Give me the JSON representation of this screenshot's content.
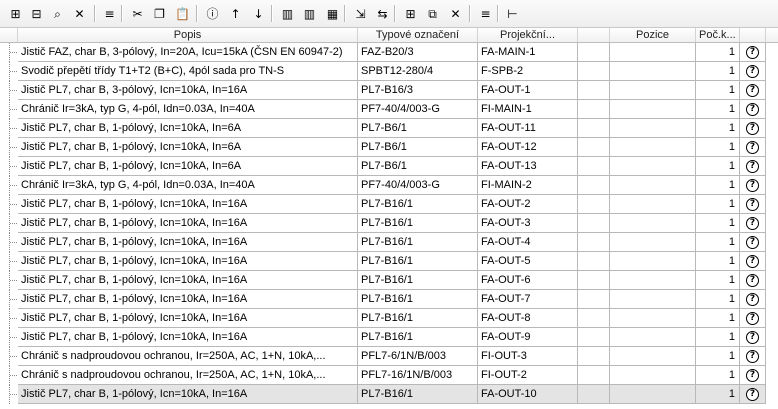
{
  "toolbar": {
    "buttons": [
      {
        "name": "tree-expand-icon",
        "glyph": "⊞"
      },
      {
        "name": "tree-collapse-icon",
        "glyph": "⊟"
      },
      {
        "name": "binoculars-icon",
        "glyph": "⌕"
      },
      {
        "name": "filter-clear-icon",
        "glyph": "✕"
      },
      {
        "name": "numbering-icon",
        "glyph": "≡"
      },
      {
        "name": "cut-icon",
        "glyph": "✂"
      },
      {
        "name": "copy-icon",
        "glyph": "❐"
      },
      {
        "name": "paste-icon",
        "glyph": "📋"
      },
      {
        "name": "info-icon",
        "glyph": "ⓘ"
      },
      {
        "name": "sort-ascending-icon",
        "glyph": "↑"
      },
      {
        "name": "sort-descending-icon",
        "glyph": "↓"
      },
      {
        "name": "columns-left-icon",
        "glyph": "▥"
      },
      {
        "name": "columns-right-icon",
        "glyph": "▥"
      },
      {
        "name": "table-edit-icon",
        "glyph": "▦"
      },
      {
        "name": "move-item-icon",
        "glyph": "⇲"
      },
      {
        "name": "move-insert-icon",
        "glyph": "⇆"
      },
      {
        "name": "split-icon",
        "glyph": "⊞"
      },
      {
        "name": "duplicate-icon",
        "glyph": "⧉"
      },
      {
        "name": "delete-icon",
        "glyph": "✕"
      },
      {
        "name": "renumber-icon",
        "glyph": "≡"
      },
      {
        "name": "align-left-icon",
        "glyph": "⊢"
      }
    ]
  },
  "columns": {
    "popis": "Popis",
    "typ": "Typové označení",
    "projekcni": "Projekční...",
    "pozice": "Pozice",
    "pocet": "Poč.k..."
  },
  "status_icon": "?",
  "colors": {
    "selected_row": "#e4e4e4",
    "grid_line": "#b8b8b8"
  },
  "rows": [
    {
      "popis": "Jistič FAZ, char B, 3-pólový, In=20A, Icu=15kA (ČSN EN 60947-2)",
      "typ": "FAZ-B20/3",
      "projekcni": "FA-MAIN-1",
      "pozice": "",
      "pocet": "1"
    },
    {
      "popis": "Svodič přepětí třídy T1+T2 (B+C), 4pól sada pro TN-S",
      "typ": "SPBT12-280/4",
      "projekcni": "F-SPB-2",
      "pozice": "",
      "pocet": "1"
    },
    {
      "popis": "Jistič PL7, char B, 3-pólový, Icn=10kA, In=16A",
      "typ": "PL7-B16/3",
      "projekcni": "FA-OUT-1",
      "pozice": "",
      "pocet": "1"
    },
    {
      "popis": "Chránič Ir=3kA, typ G, 4-pól, Idn=0.03A, In=40A",
      "typ": "PF7-40/4/003-G",
      "projekcni": "FI-MAIN-1",
      "pozice": "",
      "pocet": "1"
    },
    {
      "popis": "Jistič PL7, char B, 1-pólový, Icn=10kA, In=6A",
      "typ": "PL7-B6/1",
      "projekcni": "FA-OUT-11",
      "pozice": "",
      "pocet": "1"
    },
    {
      "popis": "Jistič PL7, char B, 1-pólový, Icn=10kA, In=6A",
      "typ": "PL7-B6/1",
      "projekcni": "FA-OUT-12",
      "pozice": "",
      "pocet": "1"
    },
    {
      "popis": "Jistič PL7, char B, 1-pólový, Icn=10kA, In=6A",
      "typ": "PL7-B6/1",
      "projekcni": "FA-OUT-13",
      "pozice": "",
      "pocet": "1"
    },
    {
      "popis": "Chránič Ir=3kA, typ G, 4-pól, Idn=0.03A, In=40A",
      "typ": "PF7-40/4/003-G",
      "projekcni": "FI-MAIN-2",
      "pozice": "",
      "pocet": "1"
    },
    {
      "popis": "Jistič PL7, char B, 1-pólový, Icn=10kA, In=16A",
      "typ": "PL7-B16/1",
      "projekcni": "FA-OUT-2",
      "pozice": "",
      "pocet": "1"
    },
    {
      "popis": "Jistič PL7, char B, 1-pólový, Icn=10kA, In=16A",
      "typ": "PL7-B16/1",
      "projekcni": "FA-OUT-3",
      "pozice": "",
      "pocet": "1"
    },
    {
      "popis": "Jistič PL7, char B, 1-pólový, Icn=10kA, In=16A",
      "typ": "PL7-B16/1",
      "projekcni": "FA-OUT-4",
      "pozice": "",
      "pocet": "1"
    },
    {
      "popis": "Jistič PL7, char B, 1-pólový, Icn=10kA, In=16A",
      "typ": "PL7-B16/1",
      "projekcni": "FA-OUT-5",
      "pozice": "",
      "pocet": "1"
    },
    {
      "popis": "Jistič PL7, char B, 1-pólový, Icn=10kA, In=16A",
      "typ": "PL7-B16/1",
      "projekcni": "FA-OUT-6",
      "pozice": "",
      "pocet": "1"
    },
    {
      "popis": "Jistič PL7, char B, 1-pólový, Icn=10kA, In=16A",
      "typ": "PL7-B16/1",
      "projekcni": "FA-OUT-7",
      "pozice": "",
      "pocet": "1"
    },
    {
      "popis": "Jistič PL7, char B, 1-pólový, Icn=10kA, In=16A",
      "typ": "PL7-B16/1",
      "projekcni": "FA-OUT-8",
      "pozice": "",
      "pocet": "1"
    },
    {
      "popis": "Jistič PL7, char B, 1-pólový, Icn=10kA, In=16A",
      "typ": "PL7-B16/1",
      "projekcni": "FA-OUT-9",
      "pozice": "",
      "pocet": "1"
    },
    {
      "popis": "Chránič s nadproudovou ochranou, Ir=250A, AC, 1+N, 10kA,...",
      "typ": "PFL7-6/1N/B/003",
      "projekcni": "FI-OUT-3",
      "pozice": "",
      "pocet": "1"
    },
    {
      "popis": "Chránič s nadproudovou ochranou, Ir=250A, AC, 1+N, 10kA,...",
      "typ": "PFL7-16/1N/B/003",
      "projekcni": "FI-OUT-2",
      "pozice": "",
      "pocet": "1"
    },
    {
      "popis": "Jistič PL7, char B, 1-pólový, Icn=10kA, In=16A",
      "typ": "PL7-B16/1",
      "projekcni": "FA-OUT-10",
      "pozice": "",
      "pocet": "1",
      "selected": true
    }
  ]
}
